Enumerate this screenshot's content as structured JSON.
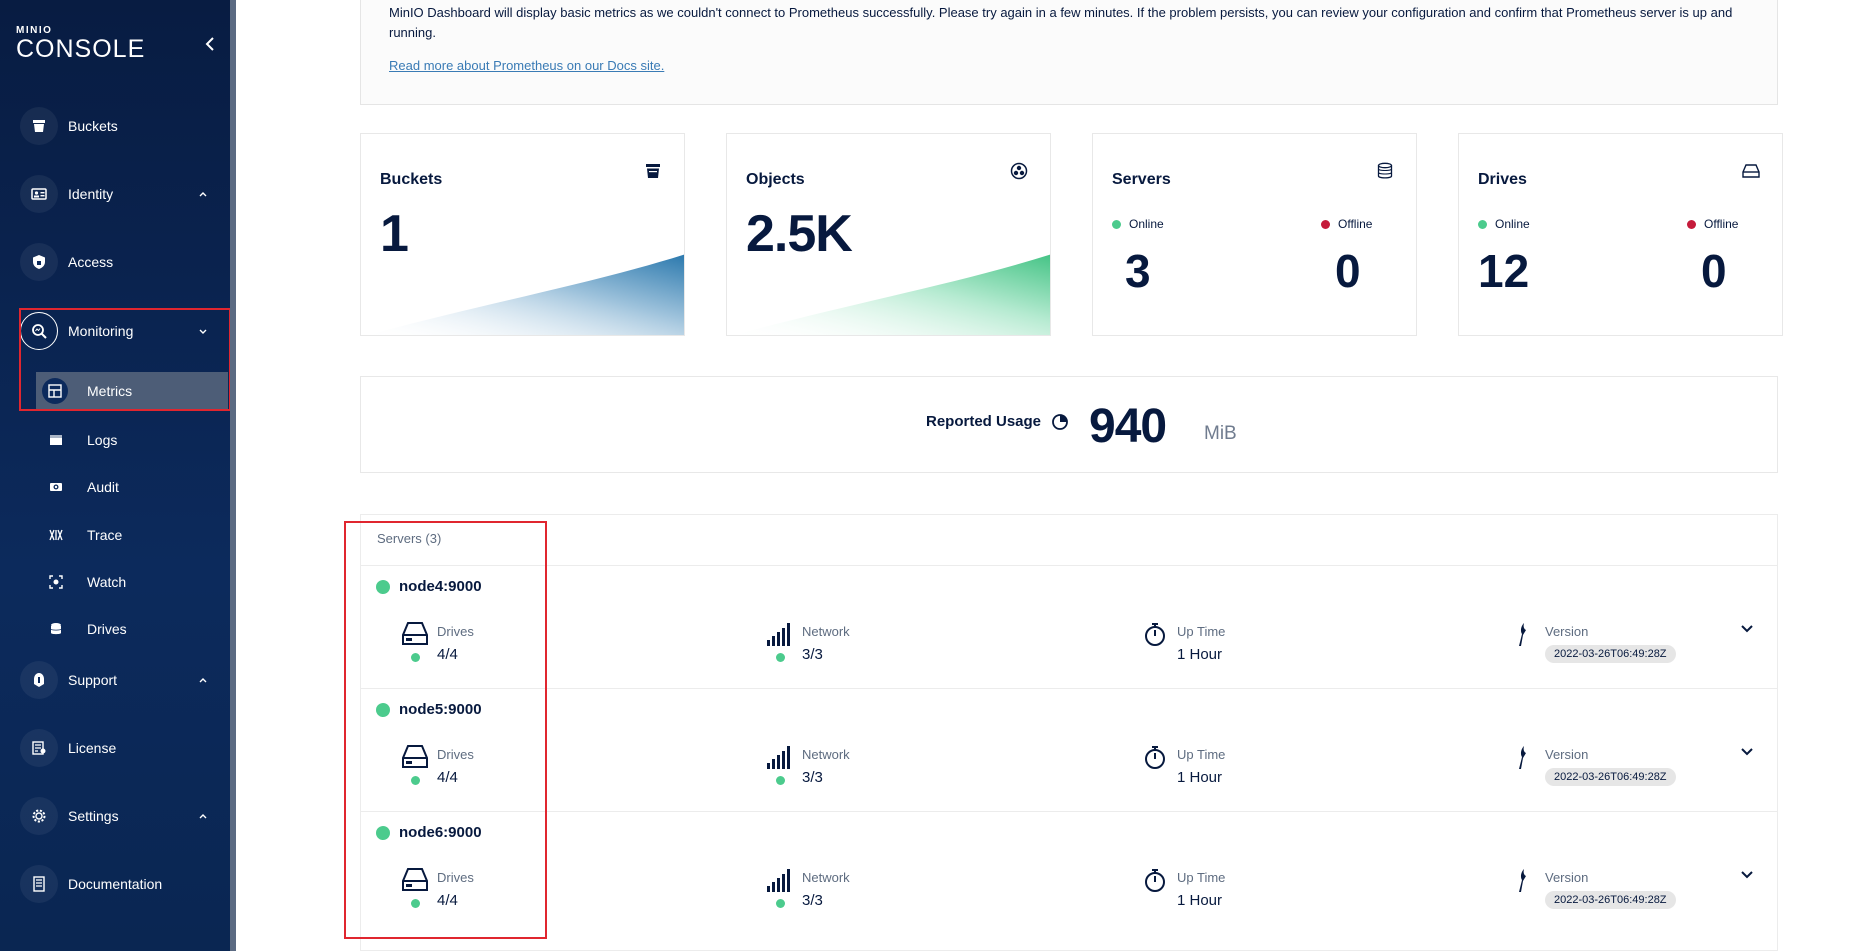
{
  "brand": {
    "top": "MINIO",
    "bottom": "CONSOLE"
  },
  "sidebar": {
    "items": [
      {
        "id": "buckets",
        "label": "Buckets",
        "icon": "bucket-icon"
      },
      {
        "id": "identity",
        "label": "Identity",
        "icon": "identity-icon"
      },
      {
        "id": "access",
        "label": "Access",
        "icon": "shield-icon"
      },
      {
        "id": "monitoring",
        "label": "Monitoring",
        "icon": "monitoring-search-icon"
      },
      {
        "id": "support",
        "label": "Support",
        "icon": "support-icon"
      },
      {
        "id": "license",
        "label": "License",
        "icon": "license-icon"
      },
      {
        "id": "settings",
        "label": "Settings",
        "icon": "gear-icon"
      },
      {
        "id": "documentation",
        "label": "Documentation",
        "icon": "documentation-icon"
      }
    ],
    "monitoring_sub": [
      {
        "id": "metrics",
        "label": "Metrics",
        "icon": "dashboard-grid-icon",
        "active": true
      },
      {
        "id": "logs",
        "label": "Logs",
        "icon": "logs-icon"
      },
      {
        "id": "audit",
        "label": "Audit",
        "icon": "audit-icon"
      },
      {
        "id": "trace",
        "label": "Trace",
        "icon": "trace-icon"
      },
      {
        "id": "watch",
        "label": "Watch",
        "icon": "watch-icon"
      },
      {
        "id": "drives",
        "label": "Drives",
        "icon": "drives-stack-icon"
      }
    ]
  },
  "alert": {
    "text": "MinIO Dashboard will display basic metrics as we couldn't connect to Prometheus successfully. Please try again in a few minutes. If the problem persists, you can review your configuration and confirm that Prometheus server is up and running.",
    "link": "Read more about Prometheus on our Docs site."
  },
  "cards": {
    "buckets": {
      "title": "Buckets",
      "value": "1"
    },
    "objects": {
      "title": "Objects",
      "value": "2.5K"
    },
    "servers": {
      "title": "Servers",
      "online_label": "Online",
      "offline_label": "Offline",
      "online": "3",
      "offline": "0"
    },
    "drives": {
      "title": "Drives",
      "online_label": "Online",
      "offline_label": "Offline",
      "online": "12",
      "offline": "0"
    }
  },
  "usage": {
    "label": "Reported Usage",
    "value": "940",
    "unit": "MiB"
  },
  "servers_list": {
    "title": "Servers (3)",
    "labels": {
      "drives": "Drives",
      "network": "Network",
      "uptime": "Up Time",
      "version": "Version"
    },
    "rows": [
      {
        "name": "node4:9000",
        "drives": "4/4",
        "network": "3/3",
        "uptime": "1 Hour",
        "version": "2022-03-26T06:49:28Z"
      },
      {
        "name": "node5:9000",
        "drives": "4/4",
        "network": "3/3",
        "uptime": "1 Hour",
        "version": "2022-03-26T06:49:28Z"
      },
      {
        "name": "node6:9000",
        "drives": "4/4",
        "network": "3/3",
        "uptime": "1 Hour",
        "version": "2022-03-26T06:49:28Z"
      }
    ]
  },
  "colors": {
    "navy": "#07193e",
    "online": "#4ccb8d",
    "offline": "#c51b3b",
    "highlight": "#e0262f"
  }
}
